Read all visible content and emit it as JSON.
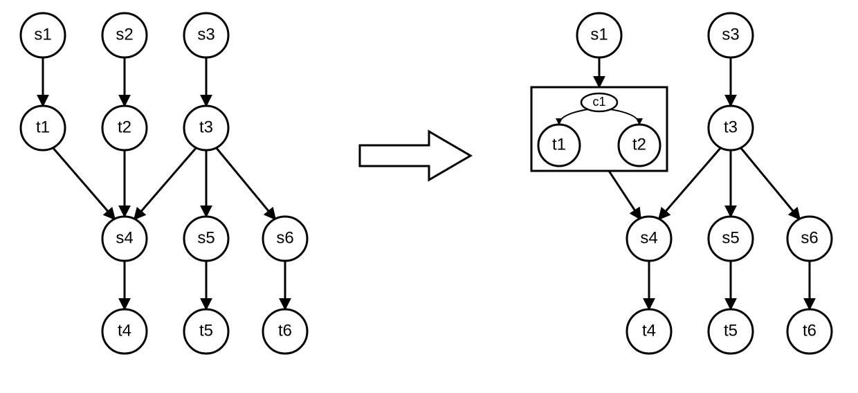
{
  "diagram": {
    "left": {
      "nodes": {
        "s1": "s1",
        "s2": "s2",
        "s3": "s3",
        "t1": "t1",
        "t2": "t2",
        "t3": "t3",
        "s4": "s4",
        "s5": "s5",
        "s6": "s6",
        "t4": "t4",
        "t5": "t5",
        "t6": "t6"
      },
      "edges": [
        [
          "s1",
          "t1"
        ],
        [
          "s2",
          "t2"
        ],
        [
          "s3",
          "t3"
        ],
        [
          "t1",
          "s4"
        ],
        [
          "t2",
          "s4"
        ],
        [
          "t3",
          "s4"
        ],
        [
          "t3",
          "s5"
        ],
        [
          "t3",
          "s6"
        ],
        [
          "s4",
          "t4"
        ],
        [
          "s5",
          "t5"
        ],
        [
          "s6",
          "t6"
        ]
      ]
    },
    "right": {
      "nodes": {
        "s1": "s1",
        "s3": "s3",
        "c1": "c1",
        "t1": "t1",
        "t2": "t2",
        "t3": "t3",
        "s4": "s4",
        "s5": "s5",
        "s6": "s6",
        "t4": "t4",
        "t5": "t5",
        "t6": "t6"
      },
      "group_box": [
        "c1",
        "t1",
        "t2"
      ],
      "edges_outer": [
        [
          "s1",
          "box"
        ],
        [
          "s3",
          "t3"
        ],
        [
          "box",
          "s4"
        ],
        [
          "t3",
          "s4"
        ],
        [
          "t3",
          "s5"
        ],
        [
          "t3",
          "s6"
        ],
        [
          "s4",
          "t4"
        ],
        [
          "s5",
          "t5"
        ],
        [
          "s6",
          "t6"
        ]
      ],
      "edges_inner": [
        [
          "c1",
          "t1"
        ],
        [
          "c1",
          "t2"
        ]
      ]
    }
  }
}
